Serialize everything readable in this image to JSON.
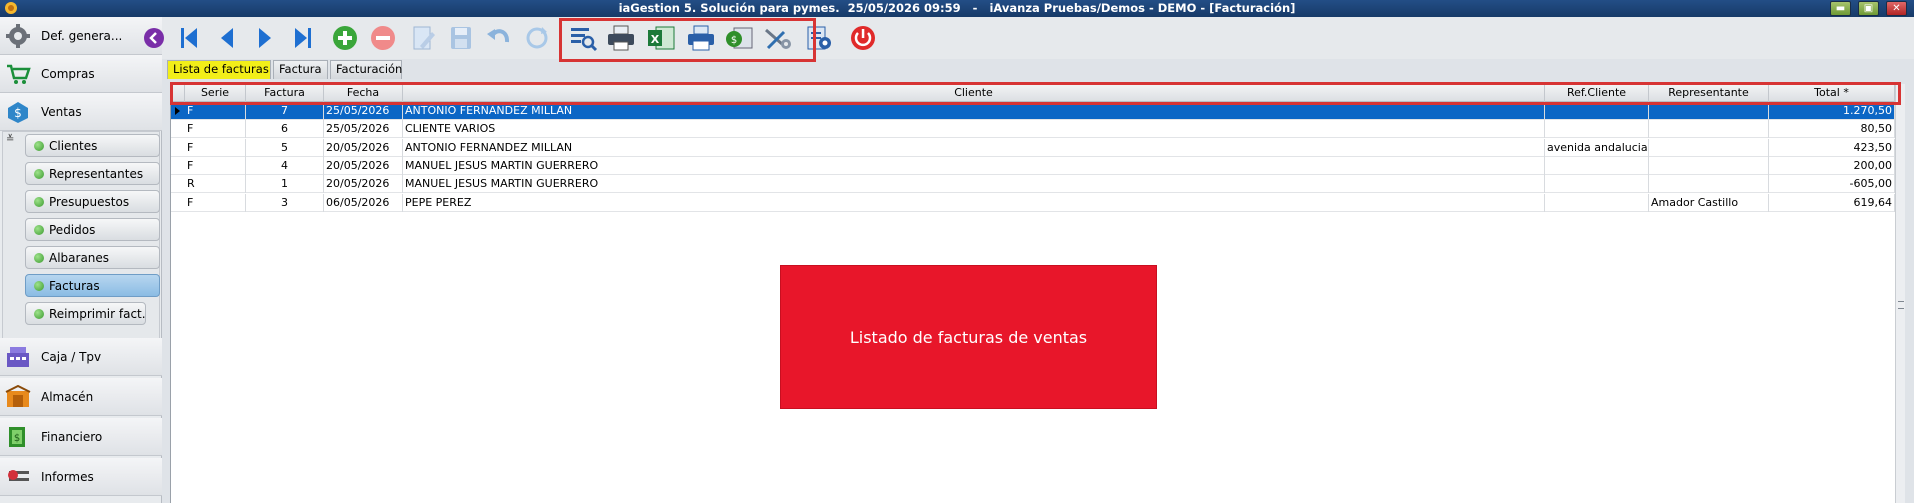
{
  "window": {
    "title": "iaGestion 5. Solución para pymes.  25/05/2026 09:59   -   iAvanza Pruebas/Demos - DEMO - [Facturación]",
    "min_label": "▬",
    "max_label": "▣",
    "close_label": "✕"
  },
  "sidebar": {
    "modules_top": [
      {
        "label": "Def. genera...",
        "icon": "gear-icon"
      },
      {
        "label": "Compras",
        "icon": "cart-icon"
      },
      {
        "label": "Ventas",
        "icon": "sales-icon"
      }
    ],
    "collapse_label": "≚",
    "sub_items": [
      {
        "label": "Clientes"
      },
      {
        "label": "Representantes"
      },
      {
        "label": "Presupuestos"
      },
      {
        "label": "Pedidos"
      },
      {
        "label": "Albaranes"
      },
      {
        "label": "Facturas"
      },
      {
        "label": "Reimprimir fact."
      }
    ],
    "modules_bottom": [
      {
        "label": "Caja / Tpv",
        "icon": "cash-register-icon"
      },
      {
        "label": "Almacén",
        "icon": "warehouse-icon"
      },
      {
        "label": "Financiero",
        "icon": "money-icon"
      },
      {
        "label": "Informes",
        "icon": "report-icon"
      }
    ]
  },
  "toolbar": {
    "icons": [
      "collapse-left-icon",
      "first-record-icon",
      "previous-record-icon",
      "next-record-icon",
      "last-record-icon",
      "add-icon",
      "delete-icon",
      "edit-icon",
      "save-icon",
      "undo-icon",
      "refresh-icon",
      "search-list-icon",
      "print-icon",
      "excel-icon",
      "print-preview-icon",
      "money-doc-icon",
      "tools-icon",
      "settings-doc-icon",
      "power-icon"
    ]
  },
  "tabs": [
    {
      "label": "Lista de facturas",
      "active": true
    },
    {
      "label": "Factura",
      "active": false
    },
    {
      "label": "Facturación",
      "active": false
    }
  ],
  "grid": {
    "columns": [
      "Serie",
      "Factura",
      "Fecha",
      "Cliente",
      "Ref.Cliente",
      "Representante",
      "Total *"
    ],
    "rows": [
      [
        "F",
        "7",
        "25/05/2026",
        "ANTONIO FERNANDEZ MILLAN",
        "",
        "",
        "1.270,50"
      ],
      [
        "F",
        "6",
        "25/05/2026",
        "CLIENTE VARIOS",
        "",
        "",
        "80,50"
      ],
      [
        "F",
        "5",
        "20/05/2026",
        "ANTONIO FERNANDEZ MILLAN",
        "avenida andalucia",
        "",
        "423,50"
      ],
      [
        "F",
        "4",
        "20/05/2026",
        "MANUEL JESUS MARTIN GUERRERO",
        "",
        "",
        "200,00"
      ],
      [
        "R",
        "1",
        "20/05/2026",
        "MANUEL JESUS MARTIN GUERRERO",
        "",
        "",
        "-605,00"
      ],
      [
        "F",
        "3",
        "06/05/2026",
        "PEPE PEREZ",
        "",
        "Amador Castillo",
        "619,64"
      ]
    ],
    "selected_row": 0
  },
  "overlay": {
    "text": "Listado de facturas de ventas",
    "color": "#e8162a"
  },
  "colors": {
    "selection": "#0b66c5",
    "highlight_tab": "#f2ee19",
    "annotation_border": "#d73434"
  }
}
